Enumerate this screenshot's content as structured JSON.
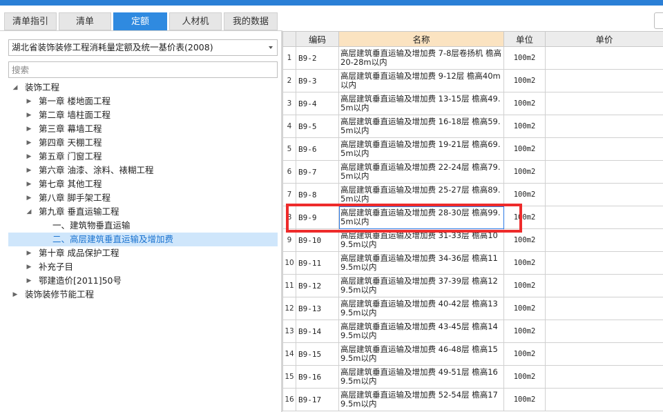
{
  "tabs": [
    {
      "label": "清单指引"
    },
    {
      "label": "清单"
    },
    {
      "label": "定额"
    },
    {
      "label": "人材机"
    },
    {
      "label": "我的数据"
    }
  ],
  "library_select": {
    "value": "湖北省装饰装修工程消耗量定额及统一基价表(2008)"
  },
  "search": {
    "placeholder": "搜索"
  },
  "tree": {
    "root": "装饰工程",
    "ch1": "第一章  楼地面工程",
    "ch2": "第二章  墙柱面工程",
    "ch3": "第三章  幕墙工程",
    "ch4": "第四章  天棚工程",
    "ch5": "第五章  门窗工程",
    "ch6": "第六章  油漆、涂料、裱糊工程",
    "ch7": "第七章  其他工程",
    "ch8": "第八章  脚手架工程",
    "ch9": "第九章  垂直运输工程",
    "ch9_s1": "一、建筑物垂直运输",
    "ch9_s2": "二、高层建筑垂直运输及增加费",
    "ch10": "第十章  成品保护工程",
    "supp": "补充子目",
    "ezj": "鄂建造价[2011]50号",
    "root2": "装饰装修节能工程"
  },
  "grid": {
    "headers": {
      "code": "编码",
      "name": "名称",
      "unit": "单位",
      "price": "单价"
    },
    "rows": [
      {
        "idx": "1",
        "code": "B9-2",
        "name": "高层建筑垂直运输及增加费 7-8层卷扬机 檐高20-28m以内",
        "unit": "100m2",
        "price": ""
      },
      {
        "idx": "2",
        "code": "B9-3",
        "name": "高层建筑垂直运输及增加费 9-12层 檐高40m以内",
        "unit": "100m2",
        "price": ""
      },
      {
        "idx": "3",
        "code": "B9-4",
        "name": "高层建筑垂直运输及增加费 13-15层 檐高49.5m以内",
        "unit": "100m2",
        "price": ""
      },
      {
        "idx": "4",
        "code": "B9-5",
        "name": "高层建筑垂直运输及增加费 16-18层 檐高59.5m以内",
        "unit": "100m2",
        "price": ""
      },
      {
        "idx": "5",
        "code": "B9-6",
        "name": "高层建筑垂直运输及增加费 19-21层 檐高69.5m以内",
        "unit": "100m2",
        "price": ""
      },
      {
        "idx": "6",
        "code": "B9-7",
        "name": "高层建筑垂直运输及增加费 22-24层 檐高79.5m以内",
        "unit": "100m2",
        "price": ""
      },
      {
        "idx": "7",
        "code": "B9-8",
        "name": "高层建筑垂直运输及增加费 25-27层 檐高89.5m以内",
        "unit": "100m2",
        "price": ""
      },
      {
        "idx": "8",
        "code": "B9-9",
        "name": "高层建筑垂直运输及增加费 28-30层 檐高99.5m以内",
        "unit": "100m2",
        "price": ""
      },
      {
        "idx": "9",
        "code": "B9-10",
        "name": "高层建筑垂直运输及增加费 31-33层 檐高109.5m以内",
        "unit": "100m2",
        "price": ""
      },
      {
        "idx": "10",
        "code": "B9-11",
        "name": "高层建筑垂直运输及增加费 34-36层 檐高119.5m以内",
        "unit": "100m2",
        "price": ""
      },
      {
        "idx": "11",
        "code": "B9-12",
        "name": "高层建筑垂直运输及增加费 37-39层 檐高129.5m以内",
        "unit": "100m2",
        "price": ""
      },
      {
        "idx": "12",
        "code": "B9-13",
        "name": "高层建筑垂直运输及增加费 40-42层 檐高139.5m以内",
        "unit": "100m2",
        "price": ""
      },
      {
        "idx": "13",
        "code": "B9-14",
        "name": "高层建筑垂直运输及增加费 43-45层 檐高149.5m以内",
        "unit": "100m2",
        "price": ""
      },
      {
        "idx": "14",
        "code": "B9-15",
        "name": "高层建筑垂直运输及增加费 46-48层 檐高159.5m以内",
        "unit": "100m2",
        "price": ""
      },
      {
        "idx": "15",
        "code": "B9-16",
        "name": "高层建筑垂直运输及增加费 49-51层 檐高169.5m以内",
        "unit": "100m2",
        "price": ""
      },
      {
        "idx": "16",
        "code": "B9-17",
        "name": "高层建筑垂直运输及增加费 52-54层 檐高179.5m以内",
        "unit": "100m2",
        "price": ""
      }
    ]
  },
  "colors": {
    "accent": "#2f8ae0",
    "highlight": "#ee2b2b",
    "header_name": "#fbe3c1",
    "tree_selected": "#cfe6fb"
  }
}
